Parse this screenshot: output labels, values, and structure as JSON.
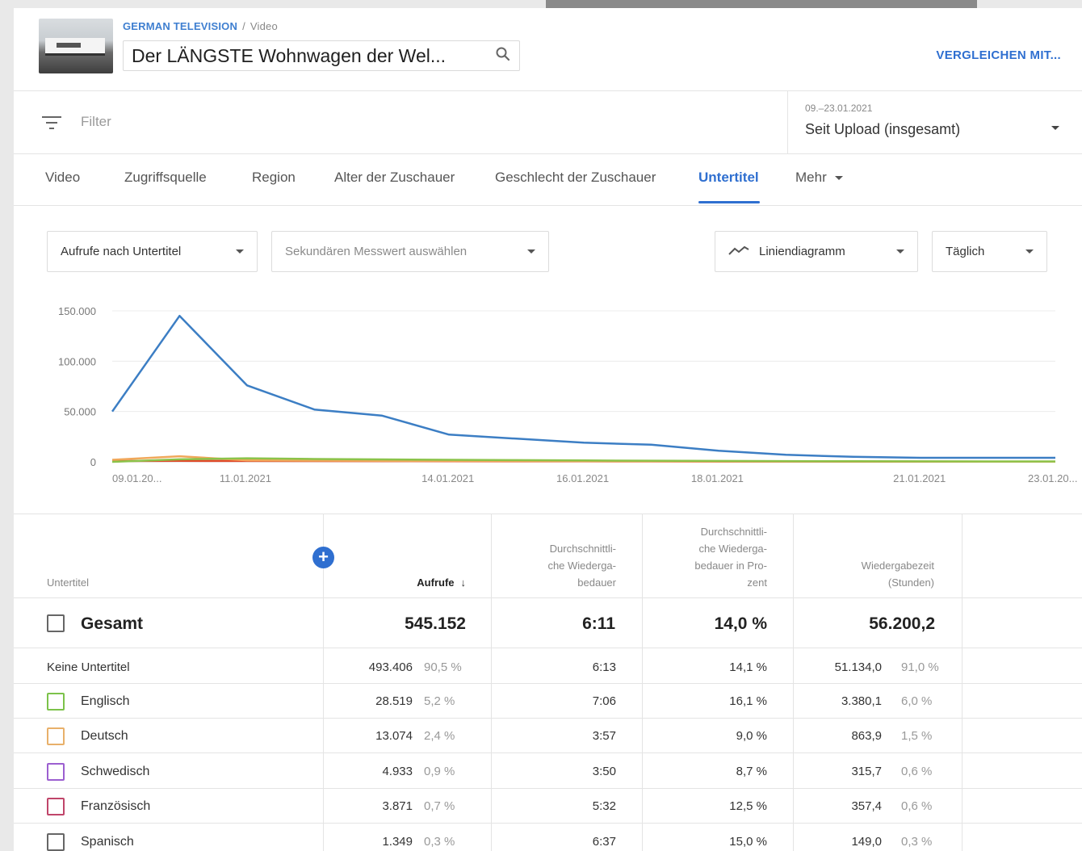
{
  "header": {
    "channel": "GERMAN TELEVISION",
    "separator": "/",
    "section": "Video",
    "video_title": "Der LÄNGSTE Wohnwagen der Wel...",
    "compare_label": "VERGLEICHEN MIT..."
  },
  "filter": {
    "placeholder": "Filter"
  },
  "date": {
    "range": "09.–23.01.2021",
    "label": "Seit Upload (insgesamt)"
  },
  "tabs": [
    {
      "label": "Video"
    },
    {
      "label": "Zugriffsquelle"
    },
    {
      "label": "Region"
    },
    {
      "label": "Alter der Zuschauer"
    },
    {
      "label": "Geschlecht der Zuschauer"
    },
    {
      "label": "Untertitel",
      "active": true
    },
    {
      "label": "Mehr"
    }
  ],
  "controls": {
    "metric": "Aufrufe nach Untertitel",
    "secondary": "Sekundären Messwert auswählen",
    "chart_type": "Liniendiagramm",
    "interval": "Täglich"
  },
  "chart_data": {
    "type": "line",
    "x": [
      "09.01.2021",
      "10.01.2021",
      "11.01.2021",
      "12.01.2021",
      "13.01.2021",
      "14.01.2021",
      "15.01.2021",
      "16.01.2021",
      "17.01.2021",
      "18.01.2021",
      "19.01.2021",
      "20.01.2021",
      "21.01.2021",
      "22.01.2021",
      "23.01.2021"
    ],
    "x_tick_labels": [
      "09.01.20...",
      "11.01.2021",
      "14.01.2021",
      "16.01.2021",
      "18.01.2021",
      "21.01.2021",
      "23.01.20..."
    ],
    "y_tick_labels": [
      "150.000",
      "100.000",
      "50.000",
      "0"
    ],
    "ylim": [
      0,
      150000
    ],
    "grid": true,
    "series": [
      {
        "color": "#3c7ec4",
        "values": [
          50000,
          145000,
          76000,
          52000,
          46000,
          27000,
          23000,
          19000,
          17000,
          11000,
          7000,
          5000,
          4000,
          4000,
          4000
        ]
      },
      {
        "color": "#8bc34a",
        "values": [
          0,
          2500,
          3500,
          2800,
          2400,
          2000,
          1700,
          1400,
          1100,
          900,
          700,
          600,
          500,
          400,
          400
        ]
      },
      {
        "color": "#f0a85a",
        "values": [
          2000,
          5500,
          1500,
          1200,
          1000,
          900,
          800,
          700,
          600,
          500,
          400,
          300,
          300,
          200,
          200
        ]
      },
      {
        "color": "#e04a2a",
        "values": [
          800,
          1000,
          900,
          800,
          700,
          600,
          500,
          450,
          400,
          350,
          300,
          250,
          200,
          180,
          150
        ]
      }
    ]
  },
  "table": {
    "headers": {
      "subtitle": "Untertitel",
      "views": "Aufrufe",
      "avg_duration": [
        "Durchschnittli-",
        "che Wiederga-",
        "bedauer"
      ],
      "avg_percent": [
        "Durchschnittli-",
        "che Wiederga-",
        "bedauer in Pro-",
        "zent"
      ],
      "watch_time": [
        "Wiedergabezeit",
        "(Stunden)"
      ]
    },
    "total": {
      "label": "Gesamt",
      "views": "545.152",
      "avg_duration": "6:11",
      "avg_percent": "14,0 %",
      "watch_time": "56.200,2"
    },
    "rows": [
      {
        "label": "Keine Untertitel",
        "color": "",
        "views": "493.406",
        "views_pct": "90,5 %",
        "avg_duration": "6:13",
        "avg_percent": "14,1 %",
        "watch_time": "51.134,0",
        "watch_pct": "91,0 %"
      },
      {
        "label": "Englisch",
        "color": "#7cc24a",
        "views": "28.519",
        "views_pct": "5,2 %",
        "avg_duration": "7:06",
        "avg_percent": "16,1 %",
        "watch_time": "3.380,1",
        "watch_pct": "6,0 %"
      },
      {
        "label": "Deutsch",
        "color": "#e8b06a",
        "views": "13.074",
        "views_pct": "2,4 %",
        "avg_duration": "3:57",
        "avg_percent": "9,0 %",
        "watch_time": "863,9",
        "watch_pct": "1,5 %"
      },
      {
        "label": "Schwedisch",
        "color": "#9c5fd0",
        "views": "4.933",
        "views_pct": "0,9 %",
        "avg_duration": "3:50",
        "avg_percent": "8,7 %",
        "watch_time": "315,7",
        "watch_pct": "0,6 %"
      },
      {
        "label": "Französisch",
        "color": "#c0456a",
        "views": "3.871",
        "views_pct": "0,7 %",
        "avg_duration": "5:32",
        "avg_percent": "12,5 %",
        "watch_time": "357,4",
        "watch_pct": "0,6 %"
      },
      {
        "label": "Spanisch",
        "color": "#666666",
        "views": "1.349",
        "views_pct": "0,3 %",
        "avg_duration": "6:37",
        "avg_percent": "15,0 %",
        "watch_time": "149,0",
        "watch_pct": "0,3 %"
      }
    ]
  }
}
